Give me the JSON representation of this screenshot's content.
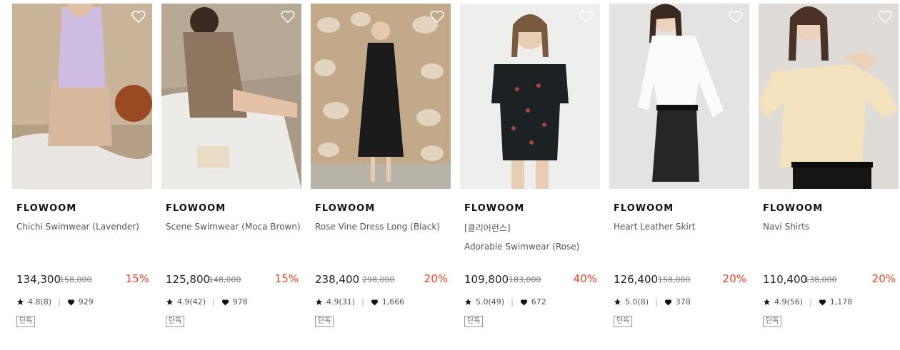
{
  "products": [
    {
      "brand": "FLOWOOM",
      "name": "Chichi Swimwear (Lavender)",
      "price": "134,300",
      "original_price": "158,000",
      "discount": "15%",
      "rating": "4.8(8)",
      "likes": "929",
      "tag": "단독"
    },
    {
      "brand": "FLOWOOM",
      "name": "Scene Swimwear (Moca Brown)",
      "price": "125,800",
      "original_price": "148,000",
      "discount": "15%",
      "rating": "4.9(42)",
      "likes": "978",
      "tag": "단독"
    },
    {
      "brand": "FLOWOOM",
      "name": "Rose Vine Dress Long (Black)",
      "price": "238,400",
      "original_price": "298,000",
      "discount": "20%",
      "rating": "4.9(31)",
      "likes": "1,666",
      "tag": "단독"
    },
    {
      "brand": "FLOWOOM",
      "name": "[클리어런스]",
      "name_line2": "Adorable Swimwear (Rose)",
      "price": "109,800",
      "original_price": "183,000",
      "discount": "40%",
      "rating": "5.0(49)",
      "likes": "672",
      "tag": "단독"
    },
    {
      "brand": "FLOWOOM",
      "name": "Heart Leather Skirt",
      "price": "126,400",
      "original_price": "158,000",
      "discount": "20%",
      "rating": "5.0(8)",
      "likes": "378",
      "tag": "단독"
    },
    {
      "brand": "FLOWOOM",
      "name": "Navi Shirts",
      "price": "110,400",
      "original_price": "138,000",
      "discount": "20%",
      "rating": "4.9(56)",
      "likes": "1,178",
      "tag": "단독"
    }
  ],
  "colors": {
    "discount": "#e8442a",
    "brand": "#111111",
    "text_muted": "#555555"
  },
  "icons": {
    "wishlist": "heart-outline-icon",
    "rating": "star-icon",
    "likes": "heart-icon"
  }
}
